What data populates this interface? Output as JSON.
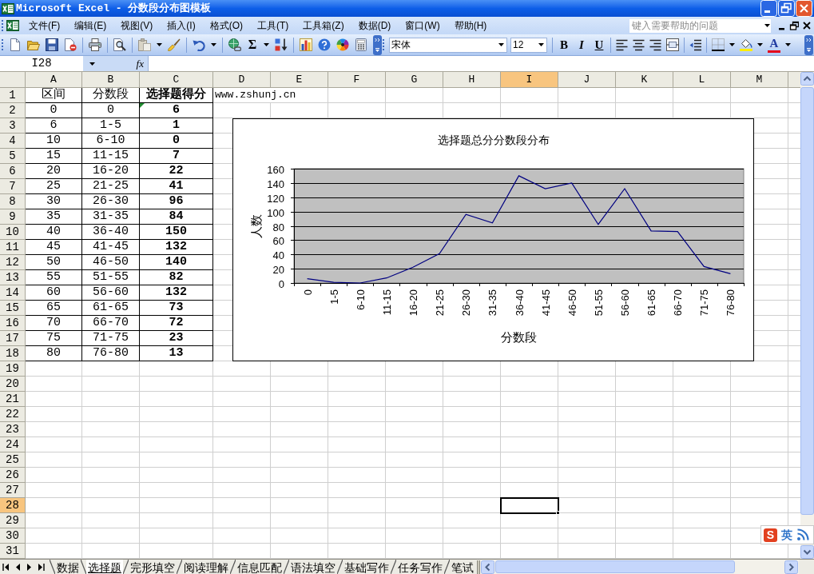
{
  "window": {
    "title": "Microsoft Excel - 分数段分布图模板"
  },
  "menu_bar": {
    "items": [
      "文件(F)",
      "编辑(E)",
      "视图(V)",
      "插入(I)",
      "格式(O)",
      "工具(T)",
      "工具箱(Z)",
      "数据(D)",
      "窗口(W)",
      "帮助(H)"
    ],
    "help_search": {
      "placeholder": "键入需要帮助的问题"
    }
  },
  "toolbar": {
    "sum": "Σ",
    "font": "宋体",
    "font_size": "12",
    "bold": "B",
    "italic": "I",
    "underline": "U",
    "font_color": "A"
  },
  "formula_bar": {
    "name_box": "I28",
    "function_button": "fx"
  },
  "sheet": {
    "columns": [
      {
        "label": "A",
        "selected": false
      },
      {
        "label": "B",
        "selected": false
      },
      {
        "label": "C",
        "selected": false
      },
      {
        "label": "D",
        "selected": false
      },
      {
        "label": "E",
        "selected": false
      },
      {
        "label": "F",
        "selected": false
      },
      {
        "label": "G",
        "selected": false
      },
      {
        "label": "H",
        "selected": false
      },
      {
        "label": "I",
        "selected": true
      },
      {
        "label": "J",
        "selected": false
      },
      {
        "label": "K",
        "selected": false
      },
      {
        "label": "L",
        "selected": false
      },
      {
        "label": "M",
        "selected": false
      }
    ],
    "rows": [
      {
        "label": "1",
        "selected": false,
        "flagged": false,
        "cells": [
          "区间",
          "分数段",
          "选择题得分",
          "www.zshunj.cn"
        ]
      },
      {
        "label": "2",
        "selected": false,
        "flagged": true,
        "cells": [
          "0",
          "0",
          "6"
        ]
      },
      {
        "label": "3",
        "selected": false,
        "flagged": false,
        "cells": [
          "6",
          "1-5",
          "1"
        ]
      },
      {
        "label": "4",
        "selected": false,
        "flagged": false,
        "cells": [
          "10",
          "6-10",
          "0"
        ]
      },
      {
        "label": "5",
        "selected": false,
        "flagged": false,
        "cells": [
          "15",
          "11-15",
          "7"
        ]
      },
      {
        "label": "6",
        "selected": false,
        "flagged": false,
        "cells": [
          "20",
          "16-20",
          "22"
        ]
      },
      {
        "label": "7",
        "selected": false,
        "flagged": false,
        "cells": [
          "25",
          "21-25",
          "41"
        ]
      },
      {
        "label": "8",
        "selected": false,
        "flagged": false,
        "cells": [
          "30",
          "26-30",
          "96"
        ]
      },
      {
        "label": "9",
        "selected": false,
        "flagged": false,
        "cells": [
          "35",
          "31-35",
          "84"
        ]
      },
      {
        "label": "10",
        "selected": false,
        "flagged": false,
        "cells": [
          "40",
          "36-40",
          "150"
        ]
      },
      {
        "label": "11",
        "selected": false,
        "flagged": false,
        "cells": [
          "45",
          "41-45",
          "132"
        ]
      },
      {
        "label": "12",
        "selected": false,
        "flagged": false,
        "cells": [
          "50",
          "46-50",
          "140"
        ]
      },
      {
        "label": "13",
        "selected": false,
        "flagged": false,
        "cells": [
          "55",
          "51-55",
          "82"
        ]
      },
      {
        "label": "14",
        "selected": false,
        "flagged": false,
        "cells": [
          "60",
          "56-60",
          "132"
        ]
      },
      {
        "label": "15",
        "selected": false,
        "flagged": false,
        "cells": [
          "65",
          "61-65",
          "73"
        ]
      },
      {
        "label": "16",
        "selected": false,
        "flagged": false,
        "cells": [
          "70",
          "66-70",
          "72"
        ]
      },
      {
        "label": "17",
        "selected": false,
        "flagged": false,
        "cells": [
          "75",
          "71-75",
          "23"
        ]
      },
      {
        "label": "18",
        "selected": false,
        "flagged": false,
        "cells": [
          "80",
          "76-80",
          "13"
        ]
      },
      {
        "label": "19",
        "selected": false,
        "flagged": false
      },
      {
        "label": "20",
        "selected": false,
        "flagged": false
      },
      {
        "label": "21",
        "selected": false,
        "flagged": false
      },
      {
        "label": "22",
        "selected": false,
        "flagged": false
      },
      {
        "label": "23",
        "selected": false,
        "flagged": false
      },
      {
        "label": "24",
        "selected": false,
        "flagged": false
      },
      {
        "label": "25",
        "selected": false,
        "flagged": false
      },
      {
        "label": "26",
        "selected": false,
        "flagged": false
      },
      {
        "label": "27",
        "selected": false,
        "flagged": false
      },
      {
        "label": "28",
        "selected": true,
        "flagged": false
      },
      {
        "label": "29",
        "selected": false,
        "flagged": false
      },
      {
        "label": "30",
        "selected": false,
        "flagged": false
      },
      {
        "label": "31",
        "selected": false,
        "flagged": false
      }
    ]
  },
  "chart": {
    "chart_data": {
      "type": "line",
      "title": "选择题总分分数段分布",
      "xlabel": "分数段",
      "ylabel": "人数",
      "categories": [
        "0",
        "1-5",
        "6-10",
        "11-15",
        "16-20",
        "21-25",
        "26-30",
        "31-35",
        "36-40",
        "41-45",
        "46-50",
        "51-55",
        "56-60",
        "61-65",
        "66-70",
        "71-75",
        "76-80"
      ],
      "values": [
        6,
        1,
        0,
        7,
        22,
        41,
        96,
        84,
        150,
        132,
        140,
        82,
        132,
        73,
        72,
        23,
        13
      ],
      "ylim": [
        0,
        160
      ],
      "yticks": [
        0,
        20,
        40,
        60,
        80,
        100,
        120,
        140,
        160
      ],
      "grid": true
    }
  },
  "sheet_tabs": [
    {
      "label": "数据",
      "selected": false
    },
    {
      "label": "选择题",
      "selected": true
    },
    {
      "label": "完形填空",
      "selected": false
    },
    {
      "label": "阅读理解",
      "selected": false
    },
    {
      "label": "信息匹配",
      "selected": false
    },
    {
      "label": "语法填空",
      "selected": false
    },
    {
      "label": "基础写作",
      "selected": false
    },
    {
      "label": "任务写作",
      "selected": false
    },
    {
      "label": "笔试",
      "selected": false
    }
  ],
  "ime": {
    "logo": "S",
    "mode": "英"
  }
}
